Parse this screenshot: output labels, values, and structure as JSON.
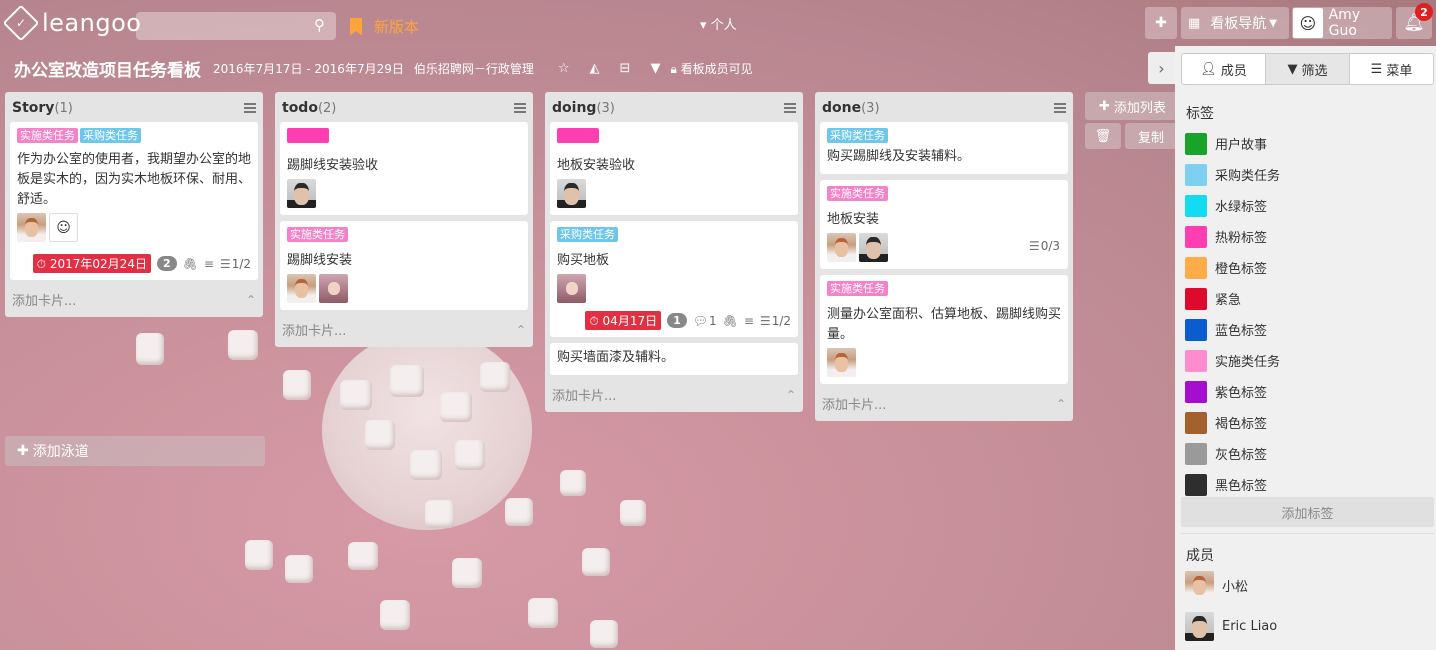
{
  "topbar": {
    "logo_text": "leangoo",
    "new_version": "新版本",
    "personal": "个人",
    "board_nav": "看板导航",
    "user_name": "Amy Guo",
    "notification_count": "2"
  },
  "board": {
    "title": "办公室改造项目任务看板",
    "dates": "2016年7月17日 - 2016年7月29日",
    "org": "伯乐招聘网－行政管理",
    "visibility": "看板成员可见"
  },
  "lists": [
    {
      "name": "Story",
      "count": "(1)",
      "add_card": "添加卡片...",
      "cards": [
        {
          "labels": [
            "实施类任务",
            "采购类任务"
          ],
          "title": "作为办公室的使用者，我期望办公室的地板是实木的，因为实木地板环保、耐用、舒适。",
          "due": "2017年02月24日",
          "comments": "2",
          "checklist": "1/2"
        }
      ]
    },
    {
      "name": "todo",
      "count": "(2)",
      "add_card": "添加卡片...",
      "cards": [
        {
          "title": "踢脚线安装验收"
        },
        {
          "labels": [
            "实施类任务"
          ],
          "title": "踢脚线安装"
        }
      ]
    },
    {
      "name": "doing",
      "count": "(3)",
      "add_card": "添加卡片...",
      "cards": [
        {
          "title": "地板安装验收"
        },
        {
          "labels": [
            "采购类任务"
          ],
          "title": "购买地板",
          "due": "04月17日",
          "comments": "1",
          "replies": "1",
          "checklist": "1/2"
        },
        {
          "title": "购买墙面漆及辅料。"
        }
      ]
    },
    {
      "name": "done",
      "count": "(3)",
      "add_card": "添加卡片...",
      "cards": [
        {
          "labels": [
            "采购类任务"
          ],
          "title": "购买踢脚线及安装辅料。"
        },
        {
          "labels": [
            "实施类任务"
          ],
          "title": "地板安装",
          "checklist": "0/3"
        },
        {
          "labels": [
            "实施类任务"
          ],
          "title": "测量办公室面积、估算地板、踢脚线购买量。"
        }
      ]
    }
  ],
  "add_lane": "添加泳道",
  "add_list": "添加列表",
  "copy": "复制",
  "panel": {
    "tabs": [
      "成员",
      "筛选",
      "菜单"
    ],
    "labels_title": "标签",
    "labels": [
      {
        "name": "用户故事",
        "color": "#1aa32b"
      },
      {
        "name": "采购类任务",
        "color": "#7dd0ef"
      },
      {
        "name": "水绿标签",
        "color": "#12dcf2"
      },
      {
        "name": "热粉标签",
        "color": "#ff3fb1"
      },
      {
        "name": "橙色标签",
        "color": "#ffab4a"
      },
      {
        "name": "紧急",
        "color": "#dd0a2b"
      },
      {
        "name": "蓝色标签",
        "color": "#0a5ccf"
      },
      {
        "name": "实施类任务",
        "color": "#ff8ccc"
      },
      {
        "name": "紫色标签",
        "color": "#a50ecf"
      },
      {
        "name": "褐色标签",
        "color": "#a3622d"
      },
      {
        "name": "灰色标签",
        "color": "#9a9a9a"
      },
      {
        "name": "黑色标签",
        "color": "#2e2e2e"
      }
    ],
    "add_label": "添加标签",
    "members_title": "成员",
    "members": [
      "小松",
      "Eric Liao"
    ]
  }
}
